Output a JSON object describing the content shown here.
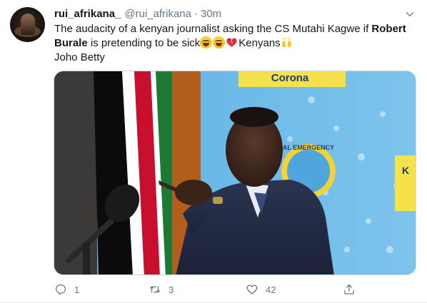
{
  "tweet": {
    "display_name": "rui_afrikana_",
    "handle": "@rui_afrikana",
    "separator": "·",
    "time": "30m",
    "text": {
      "part1": "The audacity of a kenyan journalist asking the CS Mutahi Kagwe if ",
      "bold1": "Robert",
      "bold2": "Burale",
      "part2": " is pretending to be sick",
      "part3": "Kenyans",
      "line3": "Joho Betty"
    },
    "media": {
      "sign_top": "Corona",
      "sign_badge": "AL EMERGENCY",
      "sign_right": "K"
    },
    "actions": {
      "replies": "1",
      "retweets": "3",
      "likes": "42"
    }
  },
  "icons": {
    "menu": "chevron-down-icon",
    "reply": "reply-icon",
    "retweet": "retweet-icon",
    "like": "heart-icon",
    "share": "share-icon"
  },
  "colors": {
    "secondary_text": "#657786",
    "primary_text": "#14171a",
    "divider": "#e6ecf0"
  }
}
